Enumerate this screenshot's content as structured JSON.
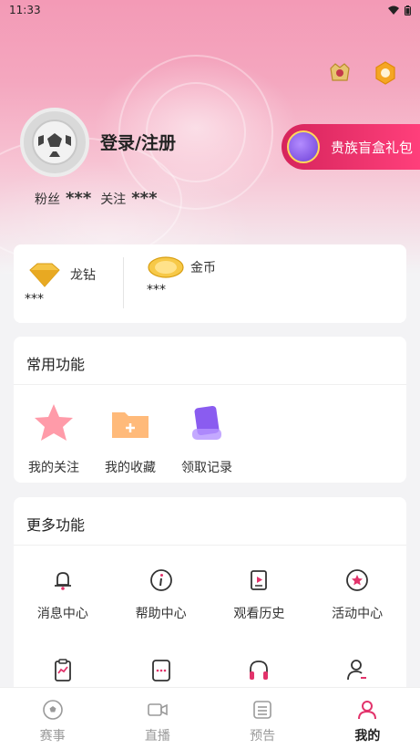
{
  "status_bar": {
    "time": "11:33"
  },
  "profile": {
    "login_label": "登录/注册",
    "fans_label": "粉丝",
    "fans_value": "***",
    "follow_label": "关注",
    "follow_value": "***"
  },
  "gift_banner": {
    "label": "贵族盲盒礼包"
  },
  "wallet": {
    "diamond_label": "龙钻",
    "diamond_value": "***",
    "coin_label": "金币",
    "coin_value": "***"
  },
  "common": {
    "title": "常用功能",
    "items": [
      {
        "label": "我的关注",
        "icon": "star-icon"
      },
      {
        "label": "我的收藏",
        "icon": "folder-icon"
      },
      {
        "label": "领取记录",
        "icon": "record-icon"
      }
    ]
  },
  "more": {
    "title": "更多功能",
    "items": [
      {
        "label": "消息中心",
        "icon": "bell-icon"
      },
      {
        "label": "帮助中心",
        "icon": "info-icon"
      },
      {
        "label": "观看历史",
        "icon": "video-history-icon"
      },
      {
        "label": "活动中心",
        "icon": "activity-star-icon"
      },
      {
        "label": "",
        "icon": "clipboard-chart-icon"
      },
      {
        "label": "",
        "icon": "chat-dots-icon"
      },
      {
        "label": "",
        "icon": "headset-icon"
      },
      {
        "label": "",
        "icon": "user-edit-icon"
      }
    ]
  },
  "tabbar": {
    "items": [
      {
        "label": "赛事",
        "icon": "soccer-ball-icon"
      },
      {
        "label": "直播",
        "icon": "camera-icon"
      },
      {
        "label": "预告",
        "icon": "list-icon"
      },
      {
        "label": "我的",
        "icon": "user-icon"
      }
    ],
    "active_color": "#e2336b"
  },
  "colors": {
    "accent": "#e2336b",
    "banner": "#ff3f7b"
  }
}
